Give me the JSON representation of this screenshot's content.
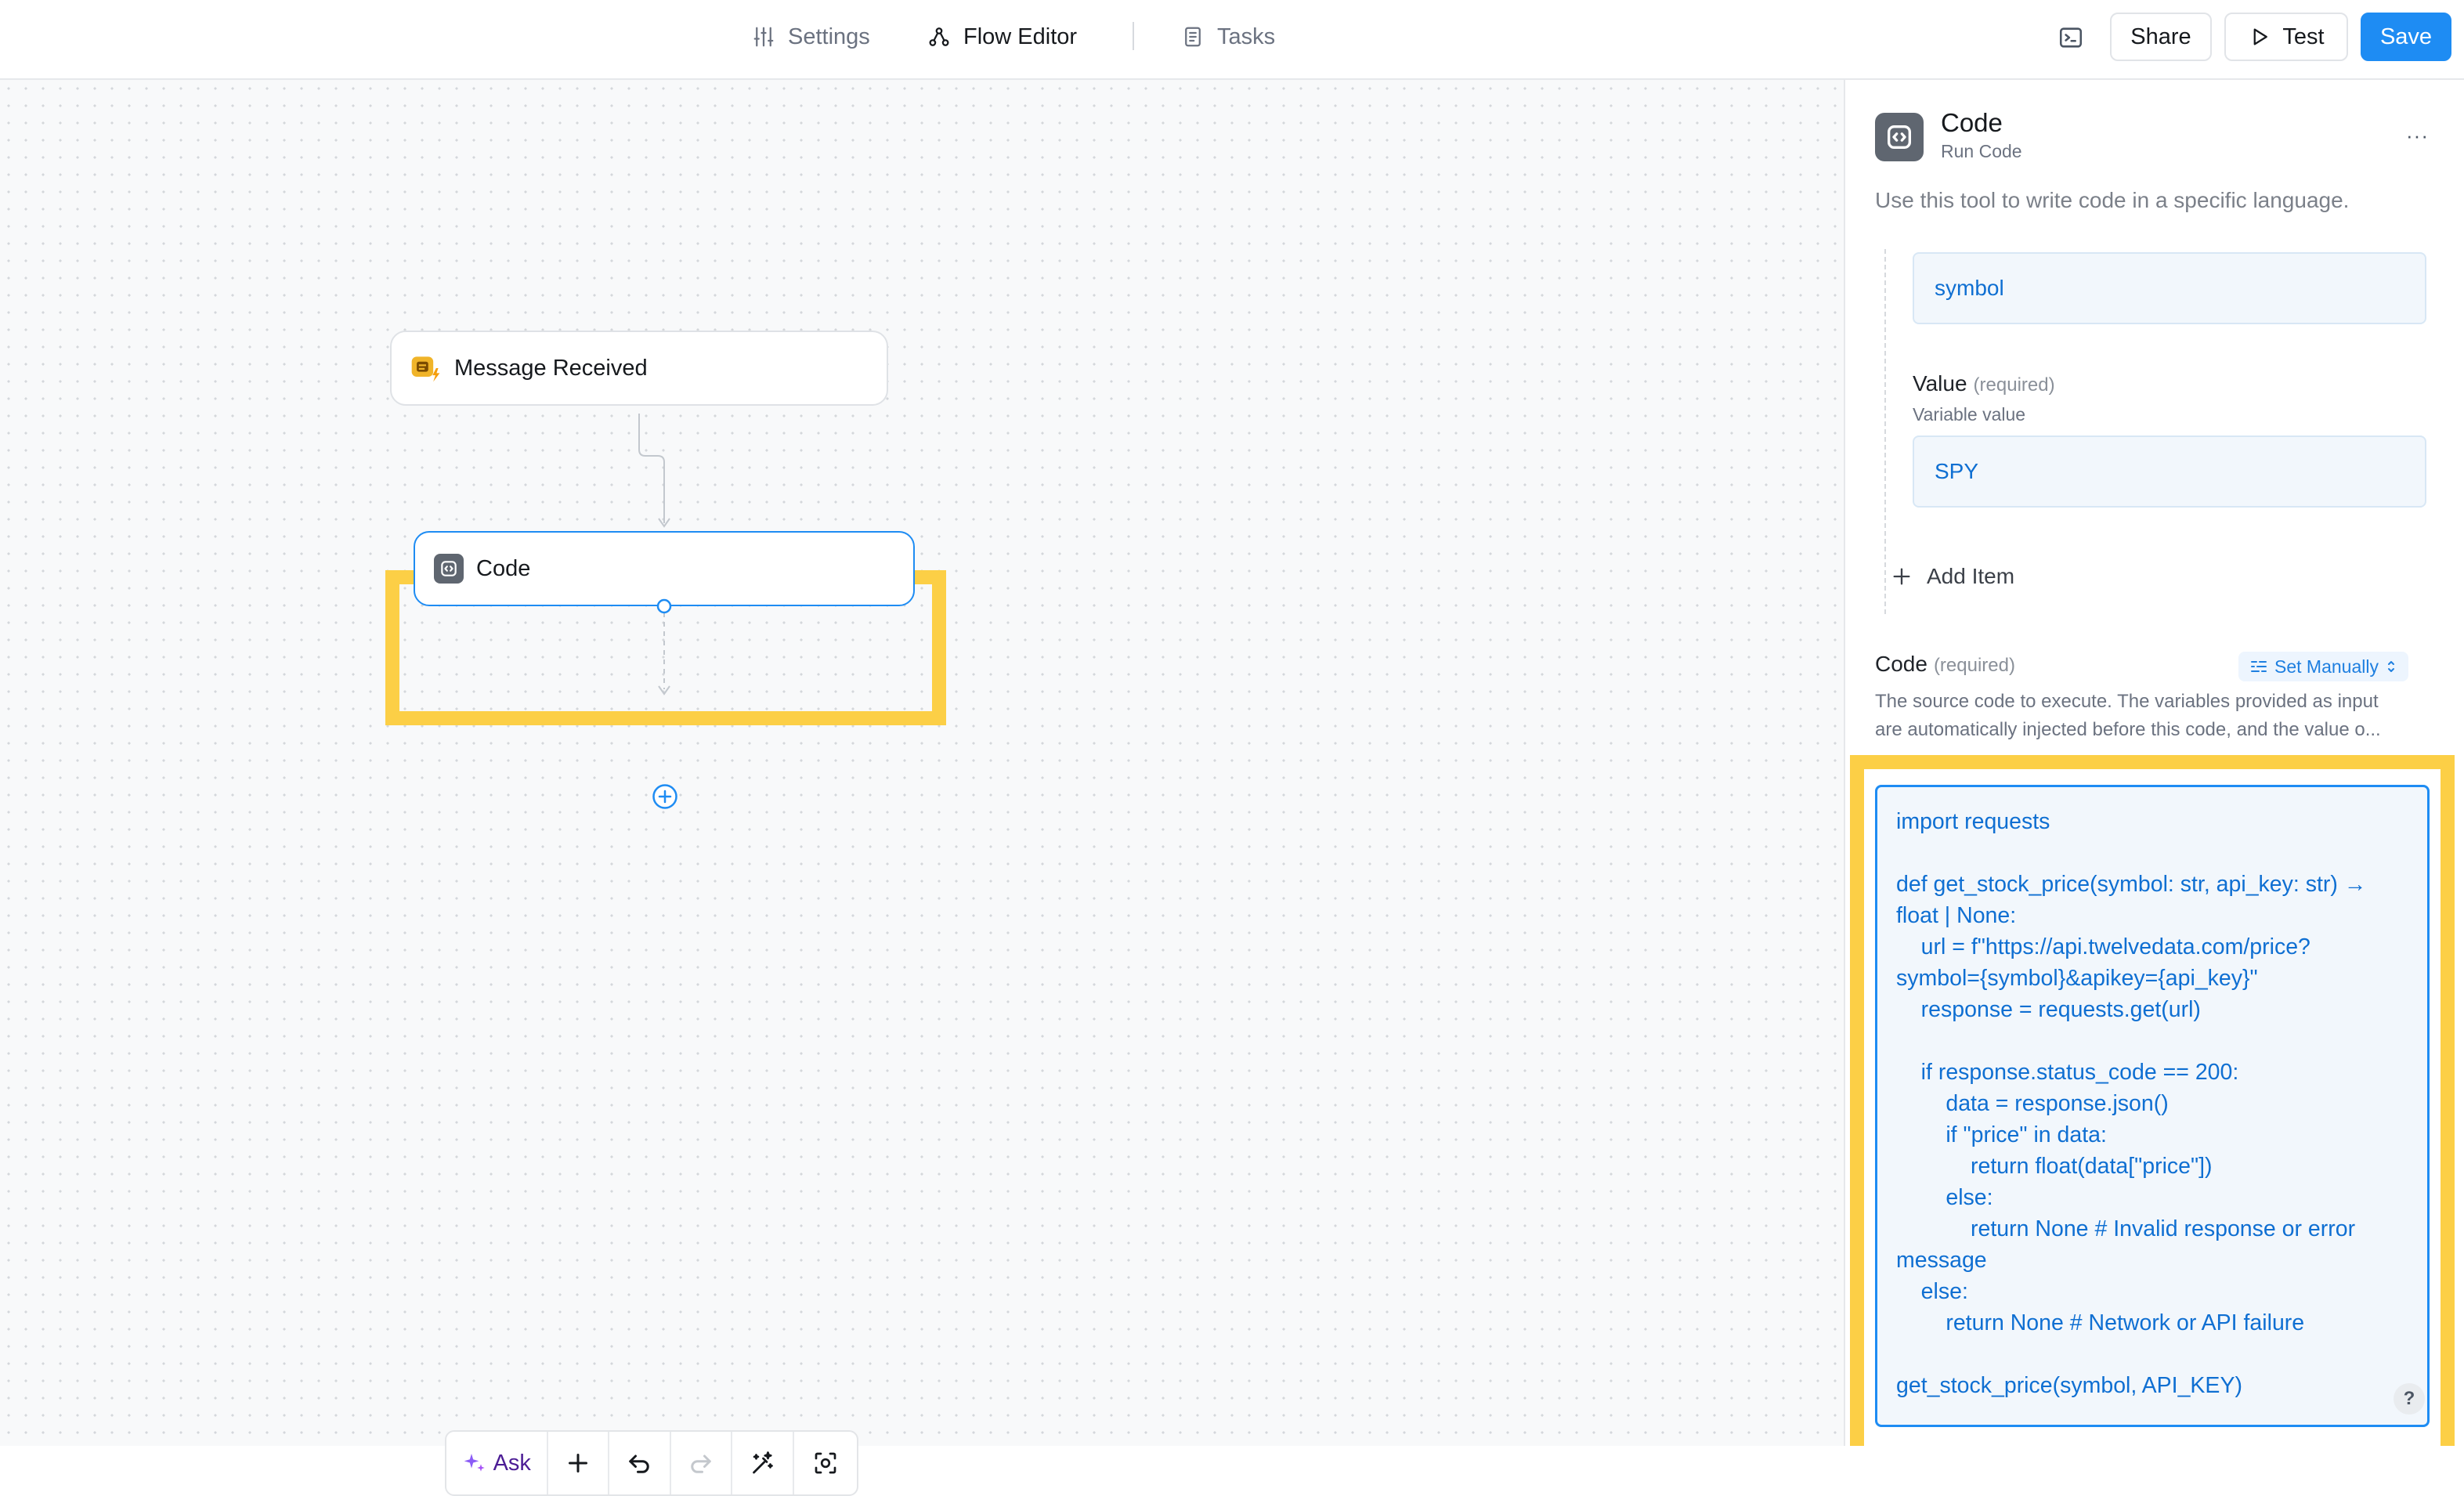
{
  "topbar": {
    "tabs": [
      {
        "label": "Settings",
        "icon": "sliders-icon",
        "active": false
      },
      {
        "label": "Flow Editor",
        "icon": "flow-icon",
        "active": true
      },
      {
        "label": "Tasks",
        "icon": "document-icon",
        "active": false
      }
    ],
    "terminal_icon": "terminal-icon",
    "share_label": "Share",
    "test_label": "Test",
    "save_label": "Save",
    "accent_color": "#1e8cf3"
  },
  "canvas": {
    "trigger_node": {
      "label": "Message Received",
      "icon": "message-trigger-icon"
    },
    "code_node": {
      "label": "Code",
      "icon": "code-icon",
      "selected": true
    },
    "highlight_color": "#fccf46",
    "toolbar": {
      "ask_label": "Ask",
      "items": [
        "sparkle-icon",
        "plus-icon",
        "undo-icon",
        "redo-icon",
        "magic-wand-icon",
        "focus-icon"
      ]
    }
  },
  "panel": {
    "title": "Code",
    "subtitle": "Run Code",
    "more_label": "···",
    "description": "Use this tool to write code in a specific language.",
    "variable_name_value": "symbol",
    "value_label": "Value",
    "value_required": "(required)",
    "value_hint": "Variable value",
    "value_value": "SPY",
    "add_item_label": "Add Item",
    "code_label": "Code",
    "code_required": "(required)",
    "set_manually_label": "Set Manually",
    "code_description_line1": "The source code to execute. The variables provided as input",
    "code_description_line2": "are automatically injected before this code, and the value o...",
    "code_lines": [
      "import requests",
      "",
      "def get_stock_price(symbol: str, api_key: str) →",
      "float | None:",
      "    url = f\"https://api.twelvedata.com/price?",
      "symbol={symbol}&apikey={api_key}\"",
      "    response = requests.get(url)",
      "",
      "    if response.status_code == 200:",
      "        data = response.json()",
      "        if \"price\" in data:",
      "            return float(data[\"price\"])",
      "        else:",
      "            return None # Invalid response or error",
      "message",
      "    else:",
      "        return None # Network or API failure",
      "",
      "get_stock_price(symbol, API_KEY)"
    ],
    "help_label": "?"
  }
}
